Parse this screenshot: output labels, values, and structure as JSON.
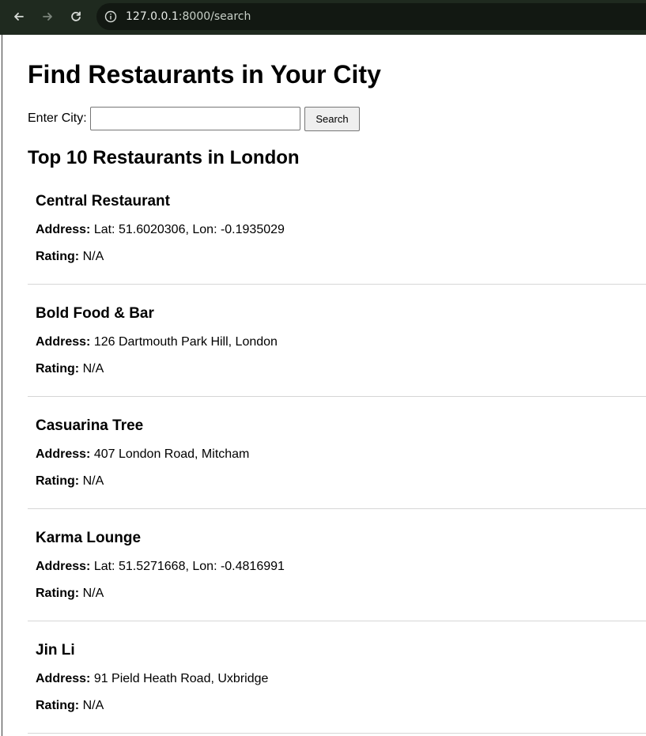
{
  "browser": {
    "url_host": "127.0.0.1",
    "url_rest": ":8000/search"
  },
  "page": {
    "title": "Find Restaurants in Your City",
    "search": {
      "label": "Enter City:",
      "value": "",
      "placeholder": "",
      "button_label": "Search"
    },
    "results_heading": "Top 10 Restaurants in London",
    "address_label": "Address:",
    "rating_label": "Rating:",
    "restaurants": [
      {
        "name": "Central Restaurant",
        "address": "Lat: 51.6020306, Lon: -0.1935029",
        "rating": "N/A"
      },
      {
        "name": "Bold Food & Bar",
        "address": "126 Dartmouth Park Hill, London",
        "rating": "N/A"
      },
      {
        "name": "Casuarina Tree",
        "address": "407 London Road, Mitcham",
        "rating": "N/A"
      },
      {
        "name": "Karma Lounge",
        "address": "Lat: 51.5271668, Lon: -0.4816991",
        "rating": "N/A"
      },
      {
        "name": "Jin Li",
        "address": "91 Pield Heath Road, Uxbridge",
        "rating": "N/A"
      }
    ]
  },
  "colors": {
    "toolbar": "#1f2a1f",
    "url_box": "#121812"
  },
  "icons": {
    "back": "arrow-left-icon",
    "forward": "arrow-right-icon",
    "reload": "reload-icon",
    "site_info": "info-icon"
  }
}
